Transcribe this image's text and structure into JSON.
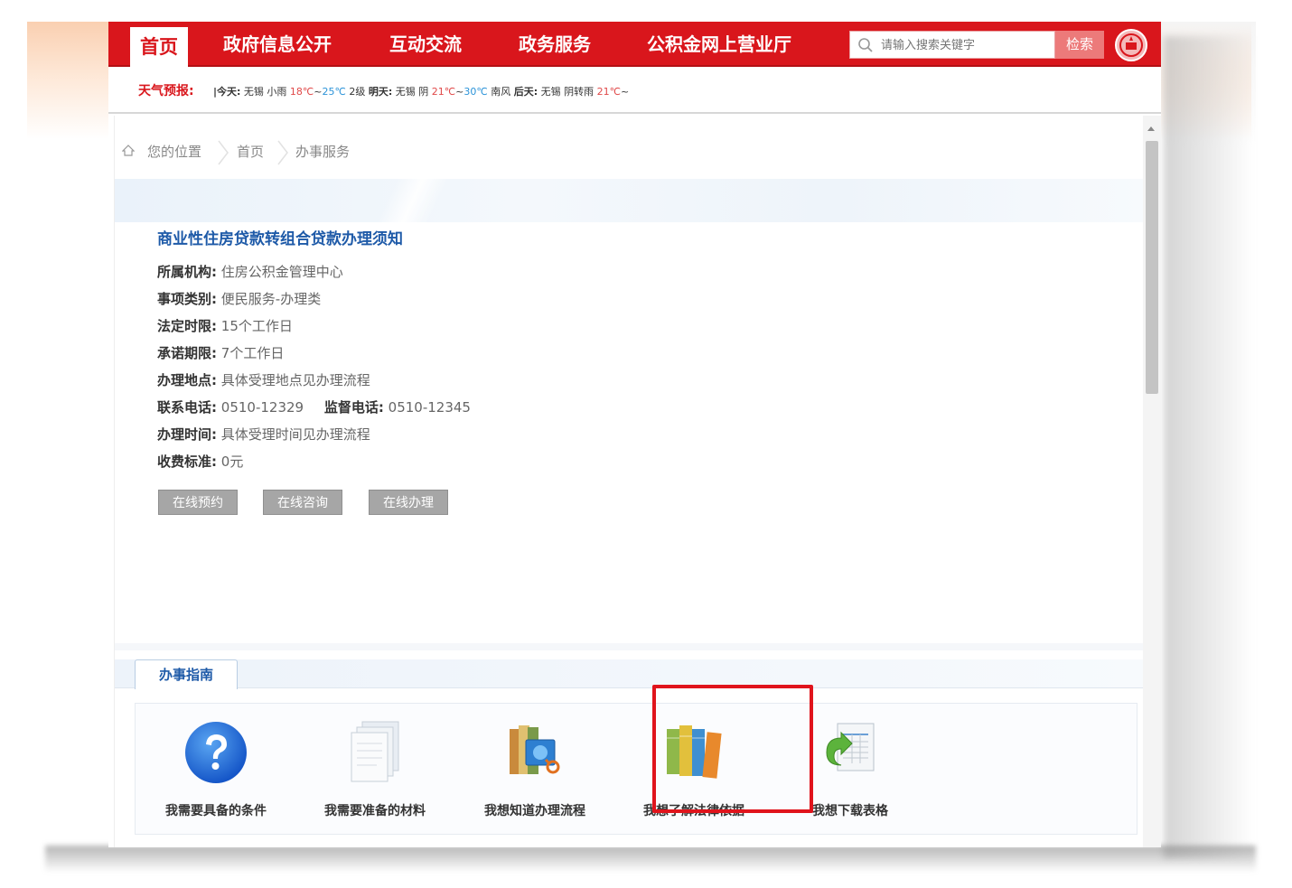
{
  "nav": {
    "home": "首页",
    "items": [
      "政府信息公开",
      "互动交流",
      "政务服务",
      "公积金网上营业厅"
    ],
    "search_placeholder": "请输入搜索关键字",
    "search_button": "检索"
  },
  "weather": {
    "title": "天气预报:",
    "today_label": "|今天:",
    "today_desc": "无锡 小雨",
    "today_low": "18℃",
    "today_sep": "~",
    "today_high": "25℃",
    "today_wind": "2级",
    "tomorrow_label": "明天:",
    "tomorrow_desc": "无锡 阴",
    "tomorrow_low": "21℃",
    "tomorrow_sep": "~",
    "tomorrow_high": "30℃",
    "tomorrow_wind": "南风",
    "after_label": "后天:",
    "after_desc": "无锡 阴转雨",
    "after_low": "21℃",
    "after_sep": "~"
  },
  "breadcrumb": {
    "prefix": "您的位置",
    "items": [
      "首页",
      "办事服务"
    ]
  },
  "page": {
    "title": "商业性住房贷款转组合贷款办理须知",
    "fields": [
      {
        "label": "所属机构:",
        "value": "住房公积金管理中心"
      },
      {
        "label": "事项类别:",
        "value": "便民服务-办理类"
      },
      {
        "label": "法定时限:",
        "value": "15个工作日"
      },
      {
        "label": "承诺期限:",
        "value": "7个工作日"
      },
      {
        "label": "办理地点:",
        "value": "具体受理地点见办理流程"
      },
      {
        "label": "联系电话:",
        "value": "0510-12329"
      },
      {
        "label": "办理时间:",
        "value": "具体受理时间见办理流程"
      },
      {
        "label": "收费标准:",
        "value": "0元"
      }
    ],
    "supervise_label": "监督电话:",
    "supervise_value": "0510-12345",
    "actions": [
      "在线预约",
      "在线咨询",
      "在线办理"
    ]
  },
  "guide": {
    "tab": "办事指南",
    "items": [
      {
        "label": "我需要具备的条件",
        "icon": "question-icon"
      },
      {
        "label": "我需要准备的材料",
        "icon": "document-icon"
      },
      {
        "label": "我想知道办理流程",
        "icon": "process-books-icon"
      },
      {
        "label": "我想了解法律依据",
        "icon": "law-books-icon"
      },
      {
        "label": "我想下载表格",
        "icon": "download-form-icon"
      }
    ]
  },
  "colors": {
    "brand_red": "#d9161c",
    "link_blue": "#1e5aa8",
    "highlight": "#e0141c"
  }
}
